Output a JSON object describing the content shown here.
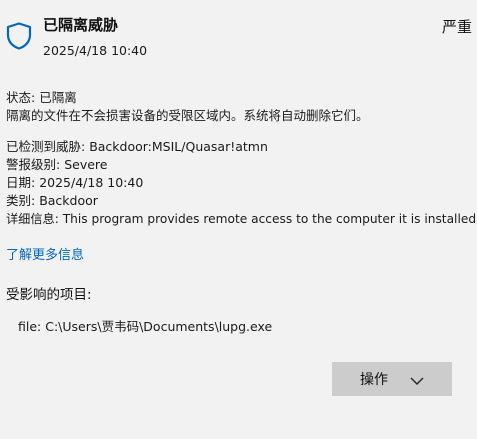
{
  "header": {
    "title": "已隔离威胁",
    "datetime": "2025/4/18 10:40",
    "severity": "严重",
    "icon": "shield-icon"
  },
  "status": {
    "label": "状态: ",
    "value": "已隔离",
    "description": "隔离的文件在不会损害设备的受限区域内。系统将自动删除它们。"
  },
  "details": [
    {
      "label": "已检测到威胁: ",
      "value": "Backdoor:MSIL/Quasar!atmn"
    },
    {
      "label": "警报级别: ",
      "value": "Severe"
    },
    {
      "label": "日期: ",
      "value": "2025/4/18 10:40"
    },
    {
      "label": "类别: ",
      "value": "Backdoor"
    },
    {
      "label": "详细信息: ",
      "value": "This program provides remote access to the computer it is installed on."
    }
  ],
  "learn_more": "了解更多信息",
  "affected": {
    "heading": "受影响的项目:",
    "items": [
      "file: C:\\Users\\贾韦码\\Documents\\lupg.exe"
    ]
  },
  "action_button": {
    "label": "操作",
    "icon": "chevron-down-icon"
  },
  "colors": {
    "accent": "#0067c0",
    "background": "#f2f2f2",
    "button": "#cccccc"
  }
}
